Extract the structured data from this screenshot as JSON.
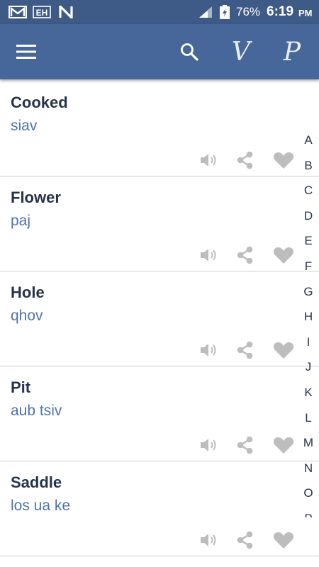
{
  "status_bar": {
    "icons": [
      "gmail-icon",
      "eh-app-icon",
      "n-app-icon"
    ],
    "eh_label": "EH",
    "battery": "76%",
    "time": "6:19",
    "ampm": "PM"
  },
  "app_bar": {
    "menu_icon": "hamburger-menu-icon",
    "search_icon": "search-icon",
    "v_button": "V",
    "p_button": "P"
  },
  "items": [
    {
      "word": "Cooked",
      "translation": "siav"
    },
    {
      "word": "Flower",
      "translation": "paj"
    },
    {
      "word": "Hole",
      "translation": "qhov"
    },
    {
      "word": "Pit",
      "translation": "aub tsiv"
    },
    {
      "word": "Saddle",
      "translation": "los ua ke"
    }
  ],
  "alphabet": [
    "A",
    "B",
    "C",
    "D",
    "E",
    "F",
    "G",
    "H",
    "I",
    "J",
    "K",
    "L",
    "M",
    "N",
    "O",
    "P"
  ],
  "colors": {
    "status_bar": "#3e5a86",
    "app_bar": "#47679a",
    "word": "#26344a",
    "translation": "#4f74a7",
    "action_icon": "#bdbdbd"
  }
}
